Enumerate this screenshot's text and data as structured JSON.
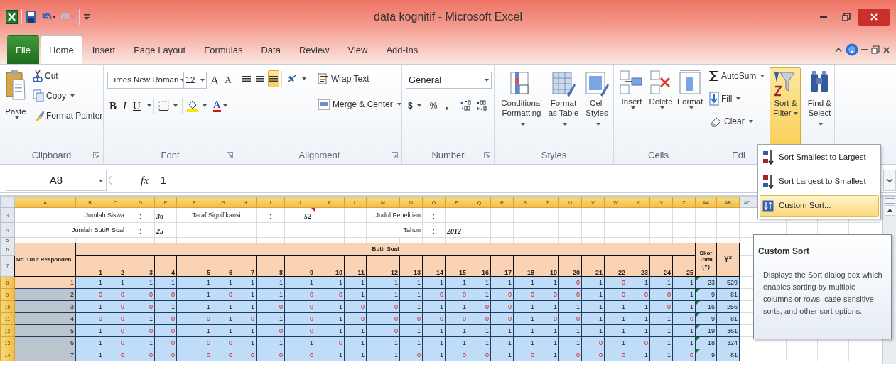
{
  "window": {
    "title": "data kognitif - Microsoft Excel"
  },
  "tabs": [
    {
      "label": "File",
      "kind": "file",
      "selected": false
    },
    {
      "label": "Home",
      "kind": "tab",
      "selected": true
    },
    {
      "label": "Insert",
      "kind": "tab",
      "selected": false
    },
    {
      "label": "Page Layout",
      "kind": "tab",
      "selected": false
    },
    {
      "label": "Formulas",
      "kind": "tab",
      "selected": false
    },
    {
      "label": "Data",
      "kind": "tab",
      "selected": false
    },
    {
      "label": "Review",
      "kind": "tab",
      "selected": false
    },
    {
      "label": "View",
      "kind": "tab",
      "selected": false
    },
    {
      "label": "Add-Ins",
      "kind": "tab",
      "selected": false
    }
  ],
  "ribbon": [
    {
      "kind": "clipboard",
      "label": "Clipboard",
      "launcher": true,
      "paste": "Paste",
      "cut": "Cut",
      "copy": "Copy",
      "format_painter": "Format Painter"
    },
    {
      "kind": "font",
      "label": "Font",
      "launcher": true,
      "font_name": "Times New Roman",
      "font_size": "12",
      "grow": "A",
      "shrink": "A",
      "bold": "B",
      "italic": "I",
      "underline": "U",
      "font_color": "A"
    },
    {
      "kind": "alignment",
      "label": "Alignment",
      "launcher": true,
      "vertical_align": [
        {
          "selected": false
        },
        {
          "selected": false
        },
        {
          "selected": true
        }
      ],
      "wrap_text": "Wrap Text",
      "merge": "Merge & Center"
    },
    {
      "kind": "number",
      "label": "Number",
      "launcher": true,
      "format": "General",
      "currency": "$",
      "percent": "%",
      "comma": ","
    },
    {
      "kind": "styles",
      "label": "Styles",
      "launcher": false,
      "buttons": [
        "Conditional Formatting",
        "Format as Table",
        "Cell Styles"
      ]
    },
    {
      "kind": "cells",
      "label": "Cells",
      "launcher": false,
      "buttons": [
        "Insert",
        "Delete",
        "Format"
      ]
    },
    {
      "kind": "editing",
      "label": "Edi",
      "launcher": false,
      "small": [
        "AutoSum",
        "Fill",
        "Clear"
      ],
      "large": [
        {
          "label": "Sort & Filter",
          "selected": true
        },
        {
          "label": "Find & Select",
          "selected": false
        }
      ]
    }
  ],
  "formula_bar": {
    "name_box": "A8",
    "function_label": "fx",
    "value": "1"
  },
  "sheet": {
    "columns": [
      {
        "label": "A",
        "selected": true
      },
      {
        "label": "B",
        "selected": true
      },
      {
        "label": "C",
        "selected": true
      },
      {
        "label": "D",
        "selected": true
      },
      {
        "label": "E",
        "selected": true
      },
      {
        "label": "F",
        "selected": true
      },
      {
        "label": "G",
        "selected": true
      },
      {
        "label": "H",
        "selected": true
      },
      {
        "label": "I",
        "selected": true
      },
      {
        "label": "J",
        "selected": true
      },
      {
        "label": "K",
        "selected": true
      },
      {
        "label": "L",
        "selected": true
      },
      {
        "label": "M",
        "selected": true
      },
      {
        "label": "N",
        "selected": true
      },
      {
        "label": "O",
        "selected": true
      },
      {
        "label": "P",
        "selected": true
      },
      {
        "label": "Q",
        "selected": true
      },
      {
        "label": "R",
        "selected": true
      },
      {
        "label": "S",
        "selected": true
      },
      {
        "label": "T",
        "selected": true
      },
      {
        "label": "U",
        "selected": true
      },
      {
        "label": "V",
        "selected": true
      },
      {
        "label": "W",
        "selected": true
      },
      {
        "label": "X",
        "selected": true
      },
      {
        "label": "Y",
        "selected": true
      },
      {
        "label": "Z",
        "selected": true
      },
      {
        "label": "AA",
        "selected": true
      },
      {
        "label": "AB",
        "selected": true
      },
      {
        "label": "AC",
        "selected": false
      }
    ],
    "row_headers": [
      {
        "label": "3",
        "selected": false
      },
      {
        "label": "4",
        "selected": false
      },
      {
        "label": "5",
        "selected": false
      },
      {
        "label": "6",
        "selected": false
      },
      {
        "label": "7",
        "selected": false
      },
      {
        "label": "8",
        "selected": true
      },
      {
        "label": "9",
        "selected": true
      },
      {
        "label": "10",
        "selected": true
      },
      {
        "label": "11",
        "selected": true
      },
      {
        "label": "12",
        "selected": true
      },
      {
        "label": "13",
        "selected": true
      },
      {
        "label": "14",
        "selected": true
      }
    ],
    "summary": {
      "left": [
        {
          "label": "Jumlah Siswa",
          "separator": ":",
          "value": "36"
        },
        {
          "label": "Jumlah ButiR Soal",
          "separator": ":",
          "value": "25"
        }
      ],
      "middle": {
        "label": "Taraf Signifikansi",
        "separator": ":",
        "value": "52",
        "comment": true
      },
      "right": [
        {
          "label": "Judul Penelitian",
          "separator": ":"
        },
        {
          "label": "Tahun",
          "separator": ":",
          "value": "2012"
        }
      ]
    },
    "table": {
      "respondent_header": "No. Urut Responden",
      "items_header": "Butir Soal",
      "item_numbers": [
        "1",
        "2",
        "3",
        "4",
        "5",
        "6",
        "7",
        "8",
        "9",
        "10",
        "11",
        "12",
        "13",
        "14",
        "15",
        "16",
        "17",
        "18",
        "19",
        "20",
        "21",
        "22",
        "23",
        "24",
        "25"
      ],
      "total_header": "Skor Total (Y)",
      "square_header": "Y$^{2}$",
      "rows": [
        {
          "no": "1",
          "active": true,
          "flagged": true,
          "answers": [
            "1",
            "1",
            "1",
            "1",
            "1",
            "1",
            "1",
            "1",
            "1",
            "1",
            "1",
            "1",
            "1",
            "1",
            "1",
            "1",
            "1",
            "1",
            "1",
            "0",
            "1",
            "0",
            "1",
            "1",
            "1"
          ],
          "total": "23",
          "square": "529"
        },
        {
          "no": "2",
          "active": false,
          "flagged": true,
          "answers": [
            "0",
            "0",
            "0",
            "0",
            "1",
            "0",
            "1",
            "1",
            "0",
            "0",
            "1",
            "1",
            "1",
            "0",
            "0",
            "1",
            "0",
            "0",
            "0",
            "0",
            "1",
            "0",
            "0",
            "0",
            "1"
          ],
          "total": "9",
          "square": "81"
        },
        {
          "no": "3",
          "active": false,
          "flagged": true,
          "answers": [
            "1",
            "0",
            "0",
            "1",
            "1",
            "1",
            "1",
            "0",
            "0",
            "1",
            "0",
            "0",
            "1",
            "1",
            "1",
            "0",
            "0",
            "1",
            "1",
            "1",
            "1",
            "1",
            "1",
            "0",
            "1"
          ],
          "total": "16",
          "square": "256"
        },
        {
          "no": "4",
          "active": false,
          "flagged": true,
          "answers": [
            "0",
            "0",
            "1",
            "0",
            "0",
            "1",
            "0",
            "1",
            "0",
            "1",
            "0",
            "0",
            "0",
            "0",
            "0",
            "0",
            "0",
            "1",
            "0",
            "0",
            "1",
            "1",
            "1",
            "1",
            "0"
          ],
          "total": "9",
          "square": "81"
        },
        {
          "no": "5",
          "active": false,
          "flagged": true,
          "answers": [
            "1",
            "0",
            "0",
            "0",
            "1",
            "1",
            "1",
            "0",
            "0",
            "1",
            "1",
            "0",
            "1",
            "1",
            "1",
            "1",
            "1",
            "1",
            "1",
            "1",
            "1",
            "1",
            "1",
            "1",
            "1"
          ],
          "total": "19",
          "square": "361"
        },
        {
          "no": "6",
          "active": false,
          "flagged": true,
          "answers": [
            "1",
            "0",
            "1",
            "0",
            "0",
            "0",
            "1",
            "1",
            "1",
            "0",
            "1",
            "1",
            "1",
            "1",
            "1",
            "1",
            "1",
            "1",
            "1",
            "1",
            "0",
            "1",
            "0",
            "1",
            "1"
          ],
          "total": "18",
          "square": "324"
        },
        {
          "no": "7",
          "active": false,
          "flagged": true,
          "answers": [
            "1",
            "0",
            "0",
            "0",
            "0",
            "0",
            "0",
            "0",
            "0",
            "1",
            "1",
            "1",
            "0",
            "1",
            "0",
            "0",
            "1",
            "0",
            "1",
            "0",
            "0",
            "0",
            "1",
            "1",
            "0"
          ],
          "total": "9",
          "square": "81"
        }
      ]
    }
  },
  "sort_menu": {
    "items": [
      {
        "label": "Sort Smallest to Largest",
        "kind": "ascending",
        "selected": false
      },
      {
        "label": "Sort Largest to Smallest",
        "kind": "descending",
        "selected": false
      },
      {
        "label": "Custom Sort...",
        "kind": "custom",
        "selected": true
      }
    ]
  },
  "tooltip": {
    "title": "Custom Sort",
    "text": "Displays the Sort dialog box which enables sorting by multiple columns or rows, case-sensitive sorts, and other sort options."
  }
}
